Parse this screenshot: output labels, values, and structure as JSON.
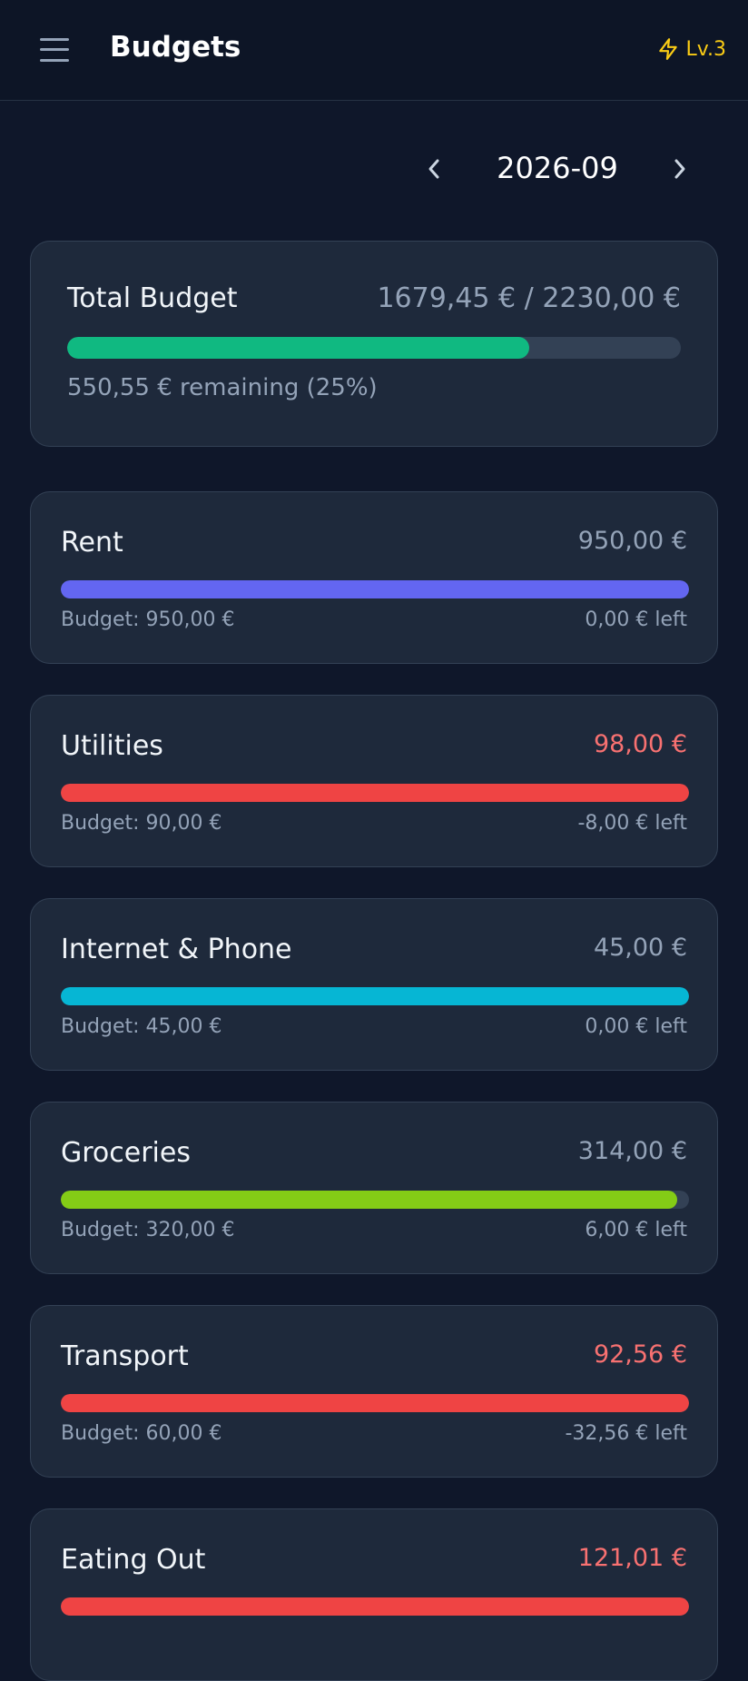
{
  "header": {
    "title": "Budgets",
    "menu_icon": "hamburger-menu-icon",
    "level_icon": "lightning-icon",
    "level_label": "Lv.3"
  },
  "month_nav": {
    "prev_icon": "chevron-left-icon",
    "next_icon": "chevron-right-icon",
    "month": "2026-09"
  },
  "total": {
    "title": "Total Budget",
    "amount": "1679,45 € / 2230,00 €",
    "remaining": "550,55 € remaining (25%)",
    "progress": 0.753,
    "color": "#10b981"
  },
  "categories": [
    {
      "name": "Rent",
      "spent": "950,00 €",
      "over": false,
      "budget": "Budget: 950,00 €",
      "left": "0,00 € left",
      "progress": 1.0,
      "color": "#6366f1"
    },
    {
      "name": "Utilities",
      "spent": "98,00 €",
      "over": true,
      "budget": "Budget: 90,00 €",
      "left": "-8,00 € left",
      "progress": 1.0,
      "color": "#ef4444"
    },
    {
      "name": "Internet & Phone",
      "spent": "45,00 €",
      "over": false,
      "budget": "Budget: 45,00 €",
      "left": "0,00 € left",
      "progress": 1.0,
      "color": "#06b6d4"
    },
    {
      "name": "Groceries",
      "spent": "314,00 €",
      "over": false,
      "budget": "Budget: 320,00 €",
      "left": "6,00 € left",
      "progress": 0.981,
      "color": "#84cc16"
    },
    {
      "name": "Transport",
      "spent": "92,56 €",
      "over": true,
      "budget": "Budget: 60,00 €",
      "left": "-32,56 € left",
      "progress": 1.0,
      "color": "#ef4444"
    },
    {
      "name": "Eating Out",
      "spent": "121,01 €",
      "over": true,
      "budget": "",
      "left": "",
      "progress": 1.0,
      "color": "#ef4444"
    }
  ],
  "colors": {
    "normal_amount": "#94a3b8",
    "over_amount": "#f87171"
  }
}
